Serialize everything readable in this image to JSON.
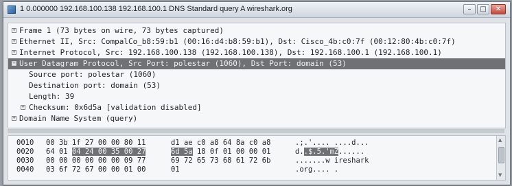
{
  "window": {
    "title": "1 0.000000 192.168.100.138 192.168.100.1 DNS Standard query A wireshark.org",
    "controls": {
      "minimize": "–",
      "maximize": "□",
      "close": "✕"
    }
  },
  "details": {
    "rows": [
      {
        "expander": "+",
        "text": "Frame 1 (73 bytes on wire, 73 bytes captured)"
      },
      {
        "expander": "+",
        "text": "Ethernet II, Src: CompalCo_b8:59:b1 (00:16:d4:b8:59:b1), Dst: Cisco_4b:c0:7f (00:12:80:4b:c0:7f)"
      },
      {
        "expander": "+",
        "text": "Internet Protocol, Src: 192.168.100.138 (192.168.100.138), Dst: 192.168.100.1 (192.168.100.1)"
      },
      {
        "expander": "−",
        "text": "User Datagram Protocol, Src Port: polestar (1060), Dst Port: domain (53)"
      },
      {
        "expander": "",
        "text": "Source port: polestar (1060)"
      },
      {
        "expander": "",
        "text": "Destination port: domain (53)"
      },
      {
        "expander": "",
        "text": "Length: 39"
      },
      {
        "expander": "+",
        "text": "Checksum: 0x6d5a [validation disabled]"
      },
      {
        "expander": "+",
        "text": "Domain Name System (query)"
      }
    ]
  },
  "bytes": {
    "rows": [
      {
        "offset": "0010",
        "hex_a": "00 3b 1f 27 00 00 80 11",
        "hex_b": "d1 ae c0 a8 64 8a c0 a8",
        "ascii": ".;.'.... ....d..."
      },
      {
        "offset": "0020",
        "hex_a": "64 01",
        "hex_sel": "04 24 00 35 00 27",
        "hex_b_sel": "6d 5a",
        "hex_b": "18 0f 01 00 00 01",
        "ascii_pre": "d.",
        "ascii_sel": ".$.5.'mZ",
        "ascii_post": "......"
      },
      {
        "offset": "0030",
        "hex_a": "00 00 00 00 00 00 09 77",
        "hex_b": "69 72 65 73 68 61 72 6b",
        "ascii": ".......w ireshark"
      },
      {
        "offset": "0040",
        "hex_a": "03 6f 72 67 00 00 01 00",
        "hex_b": "01",
        "ascii": ".org.... ."
      }
    ]
  }
}
